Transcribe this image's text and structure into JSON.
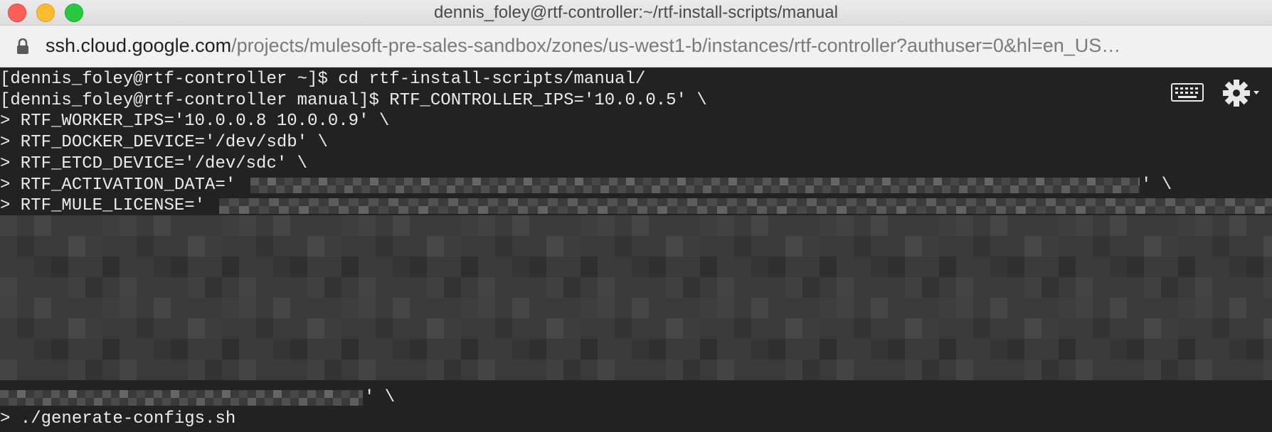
{
  "window": {
    "title": "dennis_foley@rtf-controller:~/rtf-install-scripts/manual"
  },
  "address_bar": {
    "host": "ssh.cloud.google.com",
    "path": "/projects/mulesoft-pre-sales-sandbox/zones/us-west1-b/instances/rtf-controller?authuser=0&hl=en_US…"
  },
  "terminal": {
    "lines": [
      "[dennis_foley@rtf-controller ~]$ cd rtf-install-scripts/manual/",
      "[dennis_foley@rtf-controller manual]$ RTF_CONTROLLER_IPS='10.0.0.5' \\",
      "> RTF_WORKER_IPS='10.0.0.8 10.0.0.9' \\",
      "> RTF_DOCKER_DEVICE='/dev/sdb' \\",
      "> RTF_ETCD_DEVICE='/dev/sdc' \\",
      "> RTF_ACTIVATION_DATA='",
      "' \\",
      "> RTF_MULE_LICENSE='",
      "' \\",
      "> ./generate-configs.sh"
    ]
  },
  "colors": {
    "terminal_bg": "#222222",
    "terminal_fg": "#ececec",
    "titlebar_bg": "#e4e4e4"
  },
  "icons": [
    "lock-icon",
    "keyboard-icon",
    "gear-icon"
  ]
}
